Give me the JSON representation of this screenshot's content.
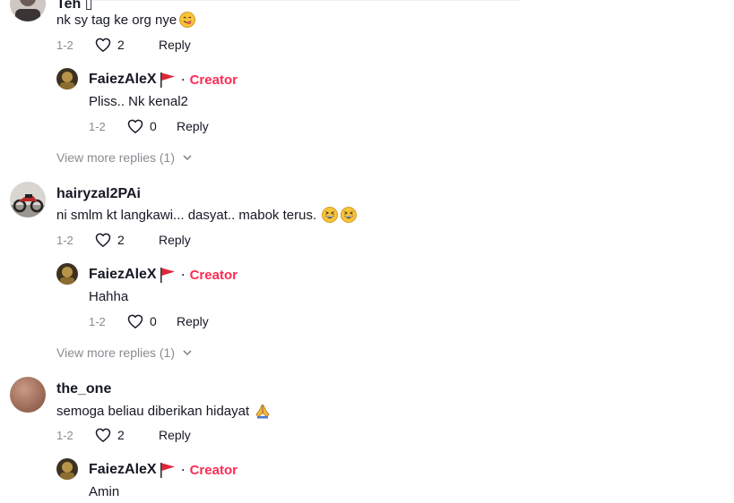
{
  "comments": [
    {
      "username": "Teh ▯",
      "text": "nk sy tag ke org nye",
      "emoji": "savoring-face",
      "date": "1-2",
      "likes": "2",
      "reply_label": "Reply",
      "reply": {
        "username": "FaiezAleX",
        "creator_label": "Creator",
        "separator": "·",
        "text": "Pliss.. Nk kenal2",
        "date": "1-2",
        "likes": "0",
        "reply_label": "Reply"
      },
      "view_more": "View more replies (1)"
    },
    {
      "username": "hairyzal2PAi",
      "text": "ni smlm kt langkawi... dasyat.. mabok terus.",
      "emoji": "grinning-squinting-face-x2",
      "date": "1-2",
      "likes": "2",
      "reply_label": "Reply",
      "reply": {
        "username": "FaiezAleX",
        "creator_label": "Creator",
        "separator": "·",
        "text": "Hahha",
        "date": "1-2",
        "likes": "0",
        "reply_label": "Reply"
      },
      "view_more": "View more replies (1)"
    },
    {
      "username": "the_one",
      "text": "semoga beliau diberikan hidayat",
      "emoji": "folded-hands",
      "date": "1-2",
      "likes": "2",
      "reply_label": "Reply",
      "reply": {
        "username": "FaiezAleX",
        "creator_label": "Creator",
        "separator": "·",
        "text": "Amin"
      }
    }
  ],
  "colors": {
    "creator": "#fe2c55",
    "muted": "#8a8b91",
    "text": "#161823",
    "flag": "#e0273b"
  },
  "icons": {
    "like": "heart-outline-icon",
    "expand": "chevron-down-icon",
    "flag": "red-flag-icon"
  }
}
